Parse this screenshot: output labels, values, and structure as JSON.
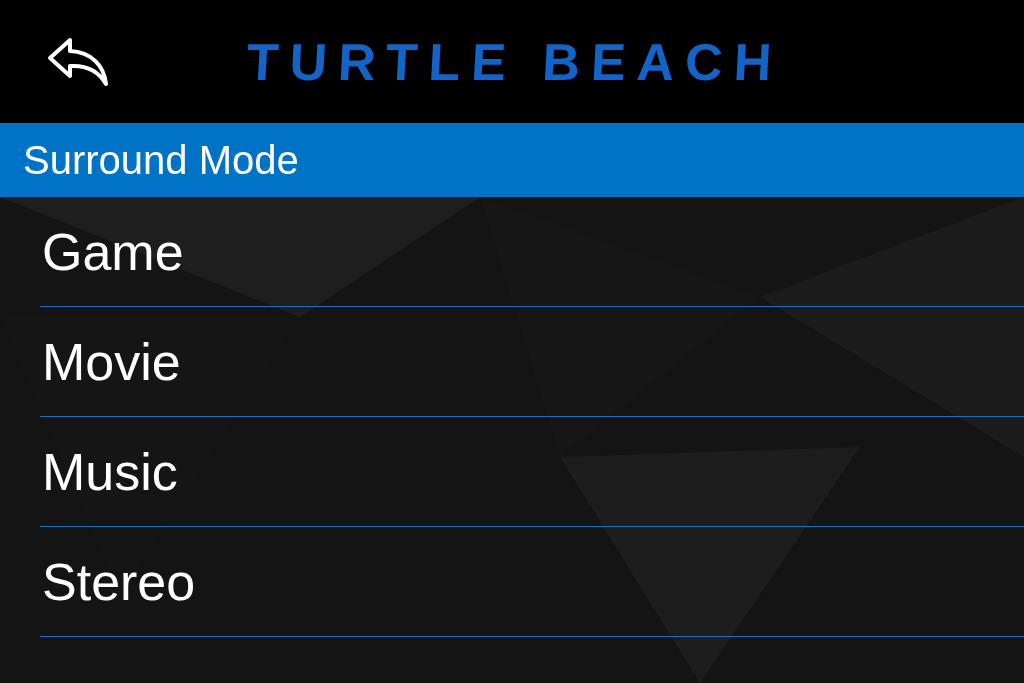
{
  "header": {
    "logo": "TURTLE BEACH"
  },
  "section": {
    "title": "Surround Mode"
  },
  "modes": [
    {
      "label": "Game"
    },
    {
      "label": "Movie"
    },
    {
      "label": "Music"
    },
    {
      "label": "Stereo"
    }
  ]
}
